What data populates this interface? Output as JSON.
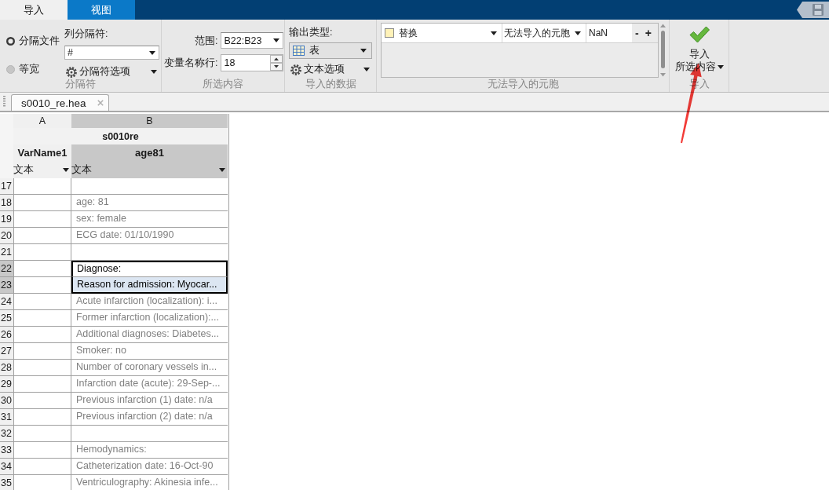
{
  "tabs": [
    {
      "label": "导入",
      "selected": true
    },
    {
      "label": "视图",
      "selected": false
    }
  ],
  "ribbon": {
    "delimiter": {
      "title": "分隔符",
      "modes": [
        {
          "label": "分隔文件",
          "selected": true
        },
        {
          "label": "等宽",
          "selected": false
        }
      ],
      "column_delimiter": {
        "label": "列分隔符:",
        "value": "#"
      },
      "options_button": "分隔符选项"
    },
    "selection": {
      "title": "所选内容",
      "range": {
        "label": "范围:",
        "value": "B22:B23"
      },
      "variable_names_row": {
        "label": "变量名称行:",
        "value": "18"
      }
    },
    "imported_data": {
      "title": "导入的数据",
      "output_type": {
        "label": "输出类型:",
        "value": "表"
      },
      "text_options_button": "文本选项"
    },
    "unimportable_cells": {
      "title": "无法导入的元胞",
      "rules": [
        {
          "color": "#fff2b8",
          "action": "替换",
          "target": "无法导入的元胞",
          "value": "NaN"
        }
      ],
      "remove_button": "-",
      "add_button": "+"
    },
    "import": {
      "title": "导入",
      "button_line_1": "导入",
      "button_line_2": "所选内容"
    }
  },
  "document_tabs": [
    {
      "label": "s0010_re.hea",
      "selected": true
    }
  ],
  "table": {
    "columns": [
      {
        "letter": "A",
        "variable_name": "VarName1",
        "type": "文本",
        "selected": false
      },
      {
        "letter": "B",
        "variable_name": "age81",
        "type": "文本",
        "selected": true
      }
    ],
    "table_name": "s0010re",
    "rows": [
      {
        "number": "17",
        "selected": false,
        "highlighted": false
      },
      {
        "number": "18",
        "value": "age: 81",
        "selected": false,
        "highlighted": false
      },
      {
        "number": "19",
        "value": "sex: female",
        "selected": false,
        "highlighted": false
      },
      {
        "number": "20",
        "value": "ECG date: 01/10/1990",
        "selected": false,
        "highlighted": false
      },
      {
        "number": "21",
        "selected": false,
        "highlighted": false
      },
      {
        "number": "22",
        "value": "Diagnose:",
        "selected": true,
        "highlighted": false
      },
      {
        "number": "23",
        "value": "Reason for admission: Myocar...",
        "selected": true,
        "highlighted": true
      },
      {
        "number": "24",
        "value": "Acute infarction (localization): i...",
        "selected": false,
        "highlighted": false
      },
      {
        "number": "25",
        "value": "Former infarction (localization):...",
        "selected": false,
        "highlighted": false
      },
      {
        "number": "26",
        "value": "Additional diagnoses: Diabetes...",
        "selected": false,
        "highlighted": false
      },
      {
        "number": "27",
        "value": "Smoker: no",
        "selected": false,
        "highlighted": false
      },
      {
        "number": "28",
        "value": "Number of coronary vessels in...",
        "selected": false,
        "highlighted": false
      },
      {
        "number": "29",
        "value": "Infarction date (acute): 29-Sep-...",
        "selected": false,
        "highlighted": false
      },
      {
        "number": "30",
        "value": "Previous infarction (1) date: n/a",
        "selected": false,
        "highlighted": false
      },
      {
        "number": "31",
        "value": "Previous infarction (2) date: n/a",
        "selected": false,
        "highlighted": false
      },
      {
        "number": "32",
        "selected": false,
        "highlighted": false
      },
      {
        "number": "33",
        "value": "Hemodynamics:",
        "selected": false,
        "highlighted": false
      },
      {
        "number": "34",
        "value": "Catheterization date: 16-Oct-90",
        "selected": false,
        "highlighted": false
      },
      {
        "number": "35",
        "value": "Ventriculography: Akinesia infe...",
        "selected": false,
        "highlighted": false
      }
    ]
  }
}
